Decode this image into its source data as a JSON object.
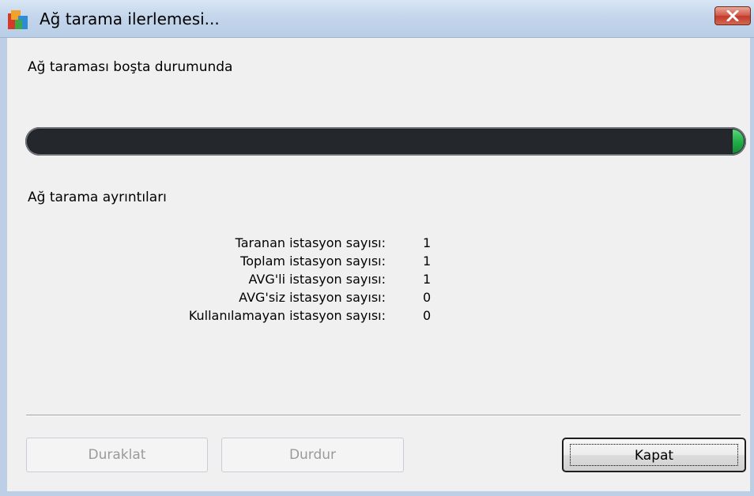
{
  "window": {
    "title": "Ağ tarama ilerlemesi...",
    "icon": "avg-logo-icon",
    "close_icon": "close-x-icon"
  },
  "status": {
    "text": "Ağ taraması boşta durumunda"
  },
  "progress": {
    "fill_fraction": 0.01,
    "track_color": "#24282d",
    "fill_color": "#23b04a"
  },
  "details": {
    "heading": "Ağ tarama ayrıntıları",
    "rows": [
      {
        "label": "Taranan istasyon sayısı:",
        "value": "1"
      },
      {
        "label": "Toplam istasyon sayısı:",
        "value": "1"
      },
      {
        "label": "AVG'li istasyon sayısı:",
        "value": "1"
      },
      {
        "label": "AVG'siz istasyon sayısı:",
        "value": "0"
      },
      {
        "label": "Kullanılamayan istasyon sayısı:",
        "value": "0"
      }
    ]
  },
  "buttons": {
    "pause_label": "Duraklat",
    "stop_label": "Durdur",
    "close_label": "Kapat"
  }
}
